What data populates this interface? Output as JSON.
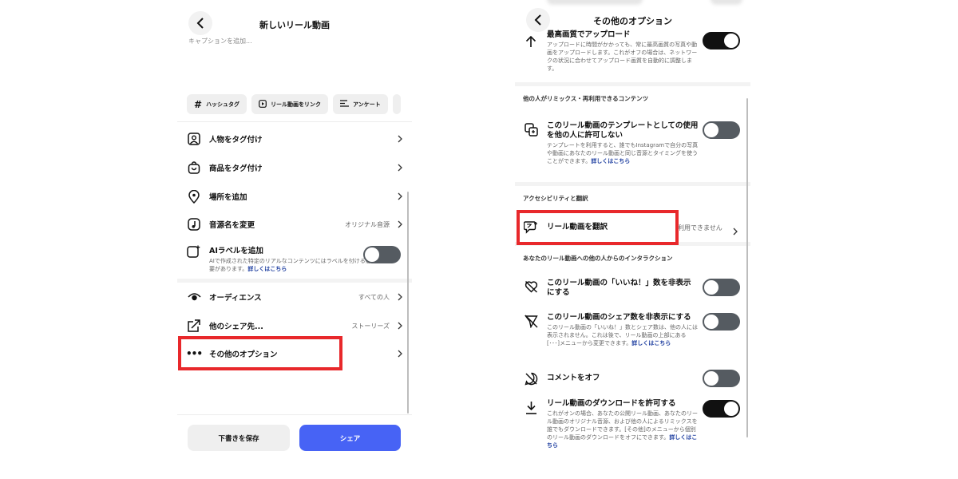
{
  "left": {
    "title": "新しいリール動画",
    "caption_placeholder": "キャプションを追加...",
    "chips": [
      {
        "label": "ハッシュタグ",
        "icon": "hashtag-icon"
      },
      {
        "label": "リール動画をリンク",
        "icon": "reel-icon"
      },
      {
        "label": "アンケート",
        "icon": "poll-icon"
      }
    ],
    "menu": [
      {
        "label": "人物をタグ付け",
        "icon": "tag-person-icon",
        "value": ""
      },
      {
        "label": "商品をタグ付け",
        "icon": "shopping-bag-icon",
        "value": ""
      },
      {
        "label": "場所を追加",
        "icon": "location-pin-icon",
        "value": ""
      },
      {
        "label": "音源名を変更",
        "icon": "music-note-icon",
        "value": "オリジナル音源"
      }
    ],
    "ai_label": {
      "title": "AIラベルを追加",
      "desc": "AIで作成された特定のリアルなコンテンツにはラベルを付ける必要があります。",
      "link": "詳しくはこちら",
      "toggle": "off"
    },
    "menu2": [
      {
        "label": "オーディエンス",
        "icon": "eye-icon",
        "value": "すべての人"
      },
      {
        "label": "他のシェア先...",
        "icon": "share-arrow-icon",
        "value": "ストーリーズ"
      },
      {
        "label": "その他のオプション",
        "icon": "more-dots-icon",
        "value": ""
      }
    ],
    "draft_button": "下書きを保存",
    "share_button": "シェア"
  },
  "right": {
    "title": "その他のオプション",
    "upload": {
      "title": "最高画質でアップロード",
      "desc": "アップロードに時間がかかっても、常に最高画質の写真や動画をアップロードします。これがオフの場合は、ネットワークの状況に合わせてアップロード画質を自動的に調整します。",
      "toggle": "on"
    },
    "section_remix": "他の人がリミックス・再利用できるコンテンツ",
    "template": {
      "title": "このリール動画のテンプレートとしての使用を他の人に許可しない",
      "desc": "テンプレートを利用すると、誰でもInstagramで自分の写真や動画にあなたのリール動画と同じ音源とタイミングを使うことができます。",
      "link": "詳しくはこちら",
      "toggle": "off"
    },
    "section_access": "アクセシビリティと翻訳",
    "translate": {
      "title": "リール動画を翻訳",
      "value": "利用できません"
    },
    "section_interact": "あなたのリール動画への他の人からのインタラクション",
    "hide_likes": {
      "title": "このリール動画の「いいね！」数を非表示にする",
      "toggle": "off"
    },
    "hide_shares": {
      "title": "このリール動画のシェア数を非表示にする",
      "desc": "このリール動画の「いいね！」数とシェア数は、他の人には表示されません。これは後で、リール動画の上部にある[･･･]メニューから変更できます。",
      "link": "詳しくはこちら",
      "toggle": "off"
    },
    "comments_off": {
      "title": "コメントをオフ",
      "toggle": "off"
    },
    "allow_download": {
      "title": "リール動画のダウンロードを許可する",
      "desc": "これがオンの場合、あなたの公開リール動画、あなたのリール動画のオリジナル音源、および他の人によるリミックスを誰でもダウンロードできます。[その他]のメニューから個別のリール動画のダウンロードをオフにできます。",
      "link": "詳しくはこちら",
      "toggle": "on"
    }
  }
}
